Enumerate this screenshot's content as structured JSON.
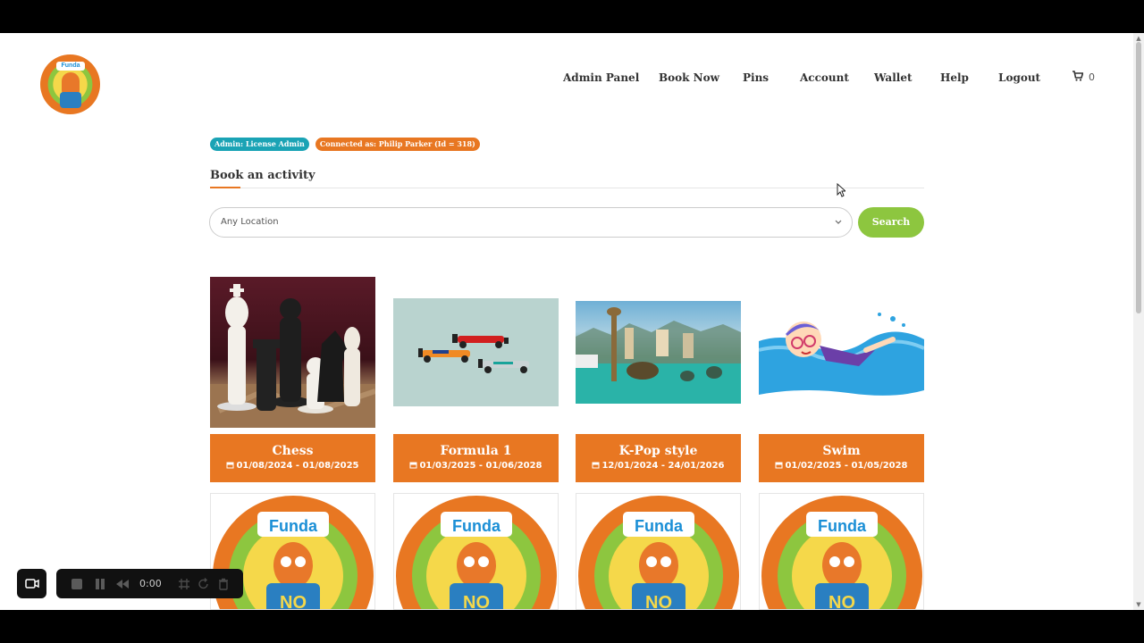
{
  "nav": {
    "items": [
      "Admin Panel",
      "Book Now",
      "Pins",
      "Account",
      "Wallet",
      "Help",
      "Logout"
    ],
    "cart_count": "0"
  },
  "logo": {
    "text": "Funda"
  },
  "badges": {
    "admin": "Admin: License Admin",
    "connected": "Connected as: Philip Parker (Id = 318)"
  },
  "section": {
    "title": "Book an activity"
  },
  "search": {
    "location_value": "Any Location",
    "button_label": "Search"
  },
  "activities": [
    {
      "name": "Chess",
      "dates": "01/08/2024 - 01/08/2025"
    },
    {
      "name": "Formula 1",
      "dates": "01/03/2025 - 01/06/2028"
    },
    {
      "name": "K-Pop style",
      "dates": "12/01/2024 - 24/01/2026"
    },
    {
      "name": "Swim",
      "dates": "01/02/2025 - 01/05/2028"
    }
  ],
  "placeholders": [
    {
      "brand": "Funda",
      "caption": "NO"
    },
    {
      "brand": "Funda",
      "caption": "NO"
    },
    {
      "brand": "Funda",
      "caption": "NO"
    },
    {
      "brand": "Funda",
      "caption": "NO"
    }
  ],
  "recorder": {
    "time": "0:00"
  },
  "colors": {
    "orange": "#e87722",
    "green": "#8dc63f",
    "teal": "#1aa3b5"
  }
}
